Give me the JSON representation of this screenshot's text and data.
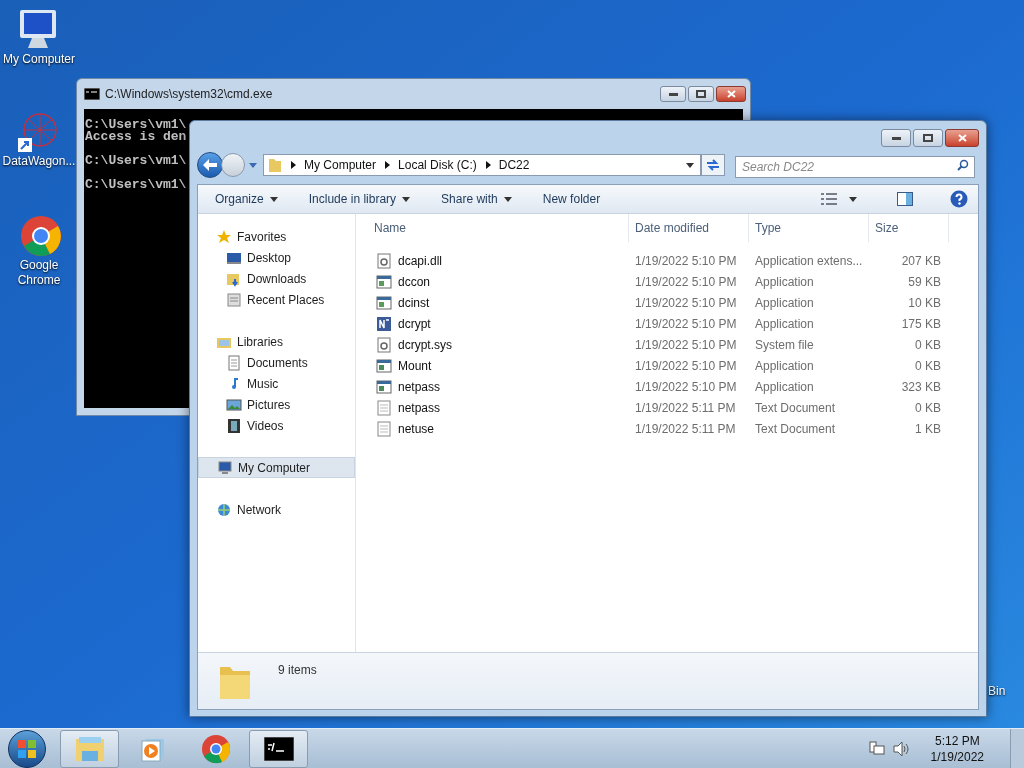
{
  "desktop_icons": [
    {
      "label": "My Computer",
      "kind": "computer"
    },
    {
      "label": "DataWagon...",
      "kind": "network-art"
    },
    {
      "label": "Google Chrome",
      "kind": "chrome"
    }
  ],
  "recycle_bin": {
    "label": "Bin"
  },
  "cmd_window": {
    "title": "C:\\Windows\\system32\\cmd.exe",
    "blocks": [
      [
        "C:\\Users\\vm1\\",
        "Access is den"
      ],
      [
        "C:\\Users\\vm1\\"
      ],
      [
        "C:\\Users\\vm1\\"
      ]
    ]
  },
  "explorer": {
    "breadcrumb": [
      "My Computer",
      "Local Disk (C:)",
      "DC22"
    ],
    "search": {
      "placeholder": "Search DC22"
    },
    "toolbar": [
      {
        "label": "Organize",
        "dropdown": true
      },
      {
        "label": "Include in library",
        "dropdown": true
      },
      {
        "label": "Share with",
        "dropdown": true
      },
      {
        "label": "New folder",
        "dropdown": false
      }
    ],
    "nav": [
      {
        "label": "Favorites",
        "kind": "star",
        "selected": false,
        "children": [
          {
            "label": "Desktop",
            "kind": "desktop",
            "selected": false
          },
          {
            "label": "Downloads",
            "kind": "downloads",
            "selected": false
          },
          {
            "label": "Recent Places",
            "kind": "recent",
            "selected": false
          }
        ]
      },
      {
        "label": "Libraries",
        "kind": "library",
        "selected": false,
        "children": [
          {
            "label": "Documents",
            "kind": "documents",
            "selected": false
          },
          {
            "label": "Music",
            "kind": "music",
            "selected": false
          },
          {
            "label": "Pictures",
            "kind": "pictures",
            "selected": false
          },
          {
            "label": "Videos",
            "kind": "videos",
            "selected": false
          }
        ]
      },
      {
        "label": "My Computer",
        "kind": "computer",
        "selected": true
      },
      {
        "label": "Network",
        "kind": "network",
        "selected": false
      }
    ],
    "columns": [
      "Name",
      "Date modified",
      "Type",
      "Size"
    ],
    "files": [
      {
        "name": "dcapi.dll",
        "date": "1/19/2022 5:10 PM",
        "type": "Application extens...",
        "size": "207 KB",
        "kind": "dll"
      },
      {
        "name": "dccon",
        "date": "1/19/2022 5:10 PM",
        "type": "Application",
        "size": "59 KB",
        "kind": "exe"
      },
      {
        "name": "dcinst",
        "date": "1/19/2022 5:10 PM",
        "type": "Application",
        "size": "10 KB",
        "kind": "exe"
      },
      {
        "name": "dcrypt",
        "date": "1/19/2022 5:10 PM",
        "type": "Application",
        "size": "175 KB",
        "kind": "dcrypt"
      },
      {
        "name": "dcrypt.sys",
        "date": "1/19/2022 5:10 PM",
        "type": "System file",
        "size": "0 KB",
        "kind": "dll"
      },
      {
        "name": "Mount",
        "date": "1/19/2022 5:10 PM",
        "type": "Application",
        "size": "0 KB",
        "kind": "app"
      },
      {
        "name": "netpass",
        "date": "1/19/2022 5:10 PM",
        "type": "Application",
        "size": "323 KB",
        "kind": "app"
      },
      {
        "name": "netpass",
        "date": "1/19/2022 5:11 PM",
        "type": "Text Document",
        "size": "0 KB",
        "kind": "txt"
      },
      {
        "name": "netuse",
        "date": "1/19/2022 5:11 PM",
        "type": "Text Document",
        "size": "1 KB",
        "kind": "txt"
      }
    ],
    "status": "9 items"
  },
  "taskbar": {
    "items": [
      {
        "kind": "explorer",
        "running": true
      },
      {
        "kind": "media",
        "running": false
      },
      {
        "kind": "chrome",
        "running": false
      },
      {
        "kind": "cmd",
        "running": true
      }
    ],
    "time": "5:12 PM",
    "date": "1/19/2022"
  }
}
